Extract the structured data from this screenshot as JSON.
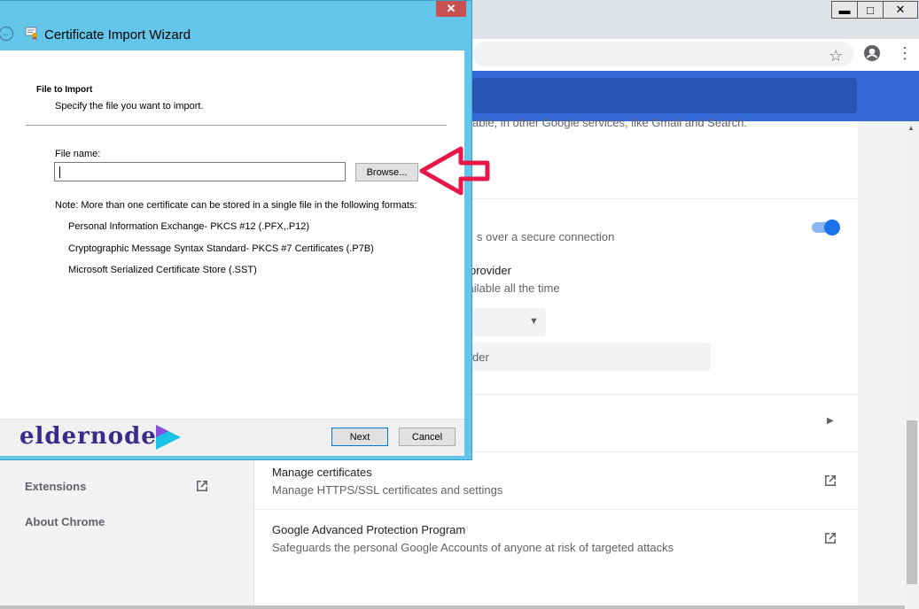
{
  "dialog": {
    "title": "Certificate Import Wizard",
    "close_glyph": "✕",
    "section_title": "File to Import",
    "section_subtitle": "Specify the file you want to import.",
    "file_label": "File name:",
    "file_value": "",
    "browse_label": "Browse...",
    "note": "Note:  More than one certificate can be stored in a single file in the following formats:",
    "formats": [
      "Personal Information Exchange- PKCS #12 (.PFX,.P12)",
      "Cryptographic Message Syntax Standard- PKCS #7 Certificates (.P7B)",
      "Microsoft Serialized Certificate Store (.SST)"
    ],
    "next_label": "Next",
    "cancel_label": "Cancel"
  },
  "logo": {
    "text": "eldernode"
  },
  "chrome": {
    "window_controls": {
      "minimize": "▬",
      "maximize": "□",
      "close": "✕"
    },
    "nav": {
      "extensions": "Extensions",
      "about": "About Chrome"
    },
    "content": {
      "partial_1": "able, in other Google services, like Gmail and Search.",
      "partial_2": "s over a secure connection",
      "partial_3": "provider",
      "partial_4": "vailable all the time",
      "partial_5": "der",
      "manage_cert_title": "Manage certificates",
      "manage_cert_desc": "Manage HTTPS/SSL certificates and settings",
      "gapp_title": "Google Advanced Protection Program",
      "gapp_desc": "Safeguards the personal Google Accounts of anyone at risk of targeted attacks"
    }
  },
  "colors": {
    "dialog_frame": "#63c5ea",
    "chrome_blue": "#3367d6",
    "toggle": "#1a73e8",
    "arrow": "#e8174a",
    "logo_purple": "#3c2a8a",
    "logo_cyan": "#19c1e6"
  }
}
